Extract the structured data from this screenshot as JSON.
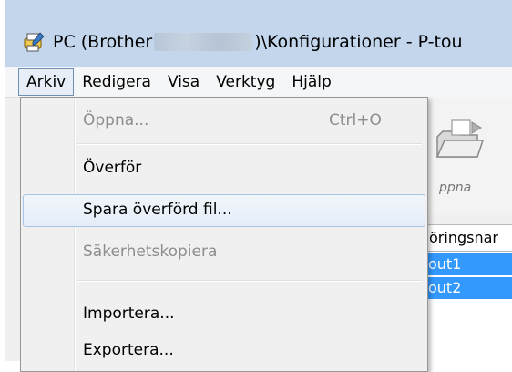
{
  "window": {
    "title_prefix": "PC (Brother",
    "title_suffix": ")\\Konfigurationer - P-tou"
  },
  "menubar": {
    "items": [
      "Arkiv",
      "Redigera",
      "Visa",
      "Verktyg",
      "Hjälp"
    ]
  },
  "arkiv_menu": {
    "open": {
      "label": "Öppna...",
      "shortcut": "Ctrl+O"
    },
    "transfer": {
      "label": "Överför"
    },
    "save_transferred": {
      "label": "Spara överförd fil..."
    },
    "backup": {
      "label": "Säkerhetskopiera"
    },
    "import": {
      "label": "Importera..."
    },
    "export": {
      "label": "Exportera..."
    }
  },
  "toolbar": {
    "open_label": "ppna"
  },
  "list": {
    "column_header": "öringsnar",
    "rows": [
      "out1",
      "out2"
    ]
  },
  "colors": {
    "selection": "#3399ff",
    "menu_highlight_border": "#a8c4e6",
    "titlebar": "#c3d6ec"
  }
}
